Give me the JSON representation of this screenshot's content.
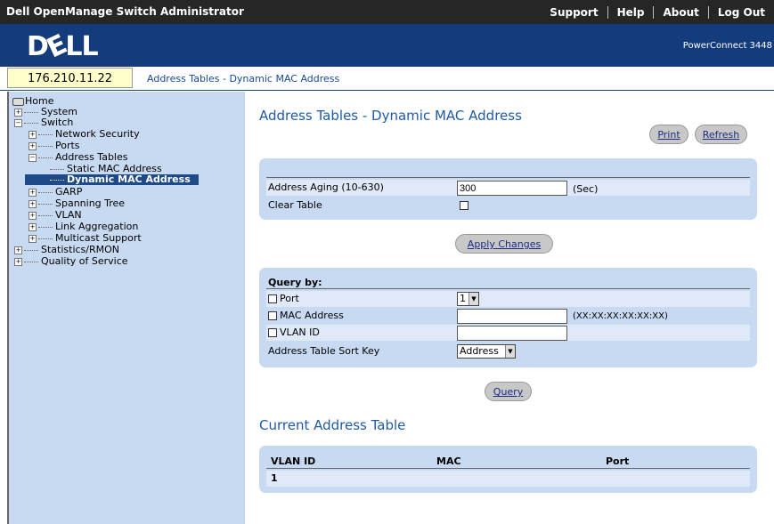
{
  "header": {
    "app_title": "Dell OpenManage Switch Administrator",
    "nav": [
      "Support",
      "Help",
      "About",
      "Log Out"
    ],
    "logo": "DELL",
    "product": "PowerConnect 3448"
  },
  "location": {
    "ip": "176.210.11.22",
    "breadcrumb": "Address Tables - Dynamic MAC Address"
  },
  "tree": {
    "home": "Home",
    "system": "System",
    "switch": "Switch",
    "network_security": "Network Security",
    "ports": "Ports",
    "address_tables": "Address Tables",
    "static_mac": "Static MAC Address",
    "dynamic_mac": "Dynamic MAC Address",
    "garp": "GARP",
    "spanning_tree": "Spanning Tree",
    "vlan": "VLAN",
    "link_aggregation": "Link Aggregation",
    "multicast_support": "Multicast Support",
    "statistics": "Statistics/RMON",
    "qos": "Quality of Service"
  },
  "page": {
    "title": "Address Tables - Dynamic MAC Address",
    "print": "Print",
    "refresh": "Refresh"
  },
  "aging": {
    "label": "Address Aging (10-630)",
    "value": "300",
    "unit": "(Sec)",
    "clear_label": "Clear Table",
    "clear_checked": false
  },
  "apply_button": "Apply Changes",
  "query": {
    "header": "Query by:",
    "port_label": "Port",
    "port_value": "1",
    "mac_label": "MAC Address",
    "mac_value": "",
    "mac_hint": "(XX:XX:XX:XX:XX:XX)",
    "vlan_label": "VLAN ID",
    "vlan_value": "",
    "sort_label": "Address Table Sort Key",
    "sort_value": "Address",
    "button": "Query"
  },
  "current_table": {
    "title": "Current Address Table",
    "columns": [
      "VLAN ID",
      "MAC",
      "Port"
    ],
    "rows": [
      [
        "1",
        "",
        ""
      ]
    ]
  }
}
